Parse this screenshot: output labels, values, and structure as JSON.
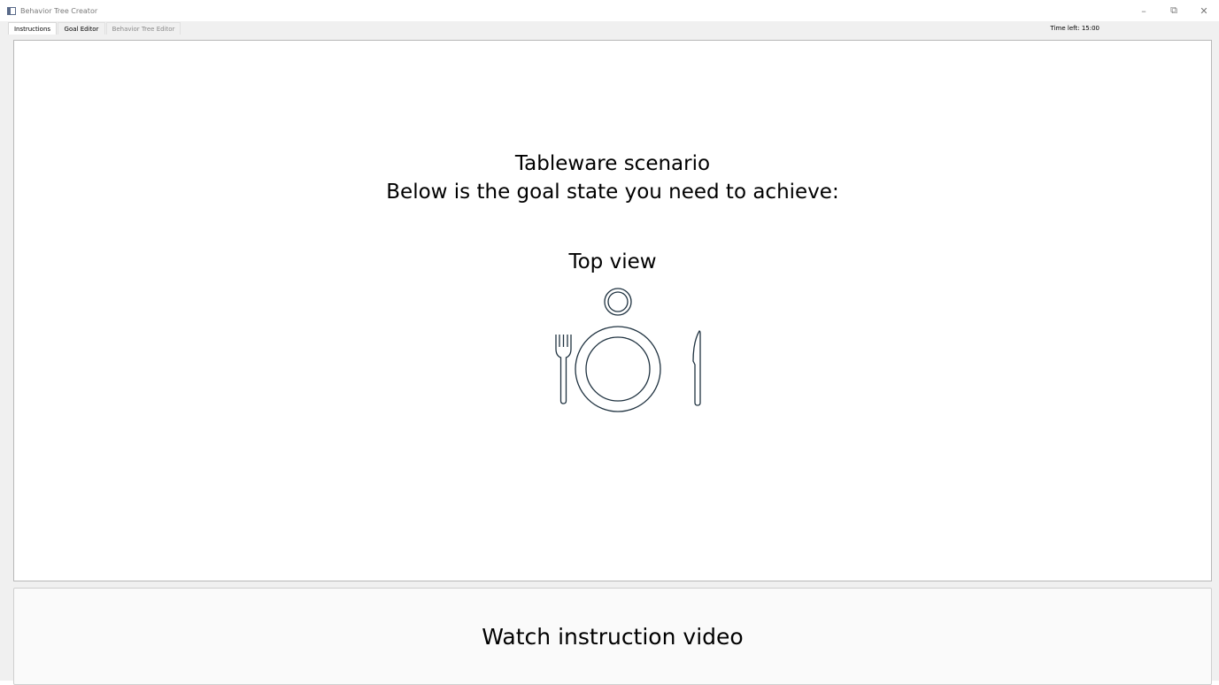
{
  "window": {
    "title": "Behavior Tree Creator",
    "controls": {
      "minimize": "–",
      "restore": "⧉",
      "close": "✕"
    }
  },
  "tabs": [
    {
      "label": "Instructions",
      "active": true
    },
    {
      "label": "Goal Editor",
      "active": false
    },
    {
      "label": "Behavior Tree Editor",
      "active": false,
      "disabled": true
    }
  ],
  "timer": {
    "label": "Time left: 15:00"
  },
  "instructions": {
    "scenario": "Tableware scenario",
    "goal_text": "Below is the goal state you need to achieve:",
    "view_label": "Top view",
    "illustration_items": [
      "cup-icon",
      "plate-icon",
      "fork-icon",
      "knife-icon"
    ],
    "stroke_color": "#1f3240"
  },
  "video_button": {
    "label": "Watch instruction video"
  }
}
